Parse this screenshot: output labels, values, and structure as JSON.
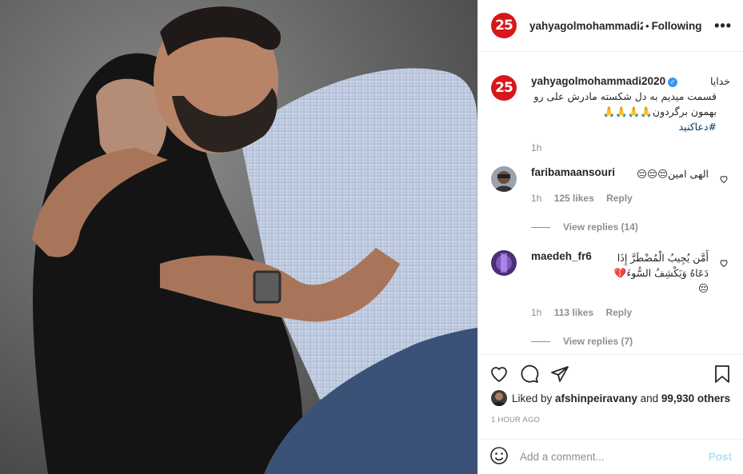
{
  "header": {
    "avatar_text": "25",
    "username": "yahyagolmohammadi2",
    "separator": "•",
    "follow_status": "Following",
    "more_label": "•••"
  },
  "caption": {
    "avatar_text": "25",
    "username": "yahyagolmohammadi2020",
    "line1": "خدایا",
    "text": "قسمت میدیم به دل شکسته مادرش علی رو بهمون برگردون🙏🙏🙏🙏",
    "hashtag": "#دعاکنید",
    "time": "1h"
  },
  "comments": [
    {
      "username": "faribamaansouri",
      "text": "الهی امین😔😔😔",
      "time": "1h",
      "likes": "125 likes",
      "reply_label": "Reply",
      "view_replies": "View replies (14)"
    },
    {
      "username": "maedeh_fr6",
      "text": "أَمَّن يُجِيبُ الْمُضْطَرَّ إِذَا دَعَاهُ وَيَكْشِفُ السُّوءَ💔😔",
      "time": "1h",
      "likes": "113 likes",
      "reply_label": "Reply",
      "view_replies": "View replies (7)"
    }
  ],
  "likes": {
    "prefix": "Liked by ",
    "liker": "afshinpeiravany",
    "middle": " and ",
    "others": "99,930 others"
  },
  "timestamp": "1 HOUR AGO",
  "add_comment": {
    "placeholder": "Add a comment...",
    "post_label": "Post"
  },
  "colors": {
    "avatar_red": "#d8161b",
    "link_blue": "#00376b",
    "verified_blue": "#3897f0",
    "post_disabled": "#b2dffc",
    "muted_gray": "#8e8e8e"
  }
}
